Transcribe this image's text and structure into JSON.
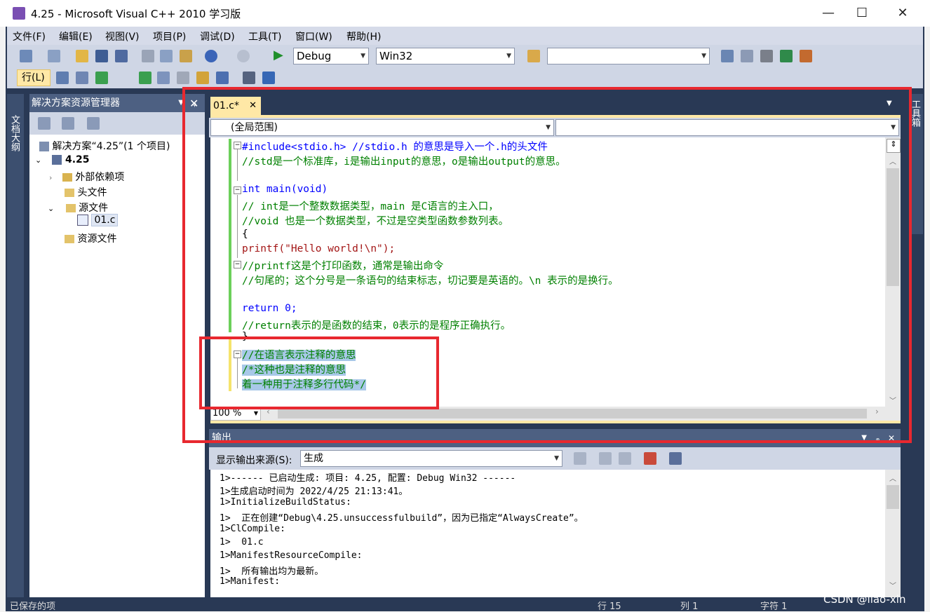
{
  "window": {
    "title": "4.25 - Microsoft Visual C++ 2010 学习版",
    "minimize": "—",
    "maximize": "☐",
    "close": "✕"
  },
  "menu": [
    "文件(F)",
    "编辑(E)",
    "视图(V)",
    "项目(P)",
    "调试(D)",
    "工具(T)",
    "窗口(W)",
    "帮助(H)"
  ],
  "toolbar": {
    "config": "Debug",
    "platform": "Win32",
    "find_value": "",
    "line_button": "行(L)"
  },
  "solution_explorer": {
    "title": "解决方案资源管理器",
    "solution": "解决方案“4.25”(1 个项目)",
    "project": "4.25",
    "items": [
      "外部依赖项",
      "头文件",
      "源文件",
      "01.c",
      "资源文件"
    ]
  },
  "side_tabs": {
    "document_outline": "文档大纲",
    "toolbox": "工具箱"
  },
  "editor": {
    "tab": "01.c*",
    "scope": "(全局范围)",
    "zoom": "100 %",
    "lines": [
      "#include<stdio.h> //stdio.h 的意思是导入一个.h的头文件",
      "//std是一个标准库，i是输出input的意思，o是输出output的意思。",
      "",
      "int main(void)",
      "// int是一个整数数据类型，main 是C语言的主入口，",
      "//void 也是一个数据类型，不过是空类型函数参数列表。",
      "{",
      "printf(\"Hello world!\\n\");",
      "//printf这是个打印函数，通常是输出命令",
      "//句尾的；这个分号是一条语句的结束标志，切记要是英语的。\\n 表示的是换行。",
      "",
      "return 0;",
      "//return表示的是函数的结束，0表示的是程序正确执行。",
      "}",
      "//在语言表示注释的意思",
      "/*这种也是注释的意思",
      "着一种用于注释多行代码*/"
    ]
  },
  "output": {
    "title": "输出",
    "source_label": "显示输出来源(S):",
    "source_value": "生成",
    "lines": [
      "1>------ 已启动生成: 项目: 4.25, 配置: Debug Win32 ------",
      "1>生成启动时间为 2022/4/25 21:13:41。",
      "1>InitializeBuildStatus:",
      "1>  正在创建“Debug\\4.25.unsuccessfulbuild”，因为已指定“AlwaysCreate”。",
      "1>ClCompile:",
      "1>  01.c",
      "1>ManifestResourceCompile:",
      "1>  所有输出均为最新。",
      "1>Manifest:"
    ]
  },
  "status": {
    "left": "已保存的项",
    "line": "行 15",
    "col": "列 1",
    "ch": "字符 1",
    "watermark": "CSDN @liao-xin"
  },
  "colors": {
    "ide_dark": "#293955",
    "tab_gold": "#ffe8a6",
    "comment_green": "#008000",
    "keyword_blue": "#0000ff",
    "highlight_red": "#e8282f"
  }
}
